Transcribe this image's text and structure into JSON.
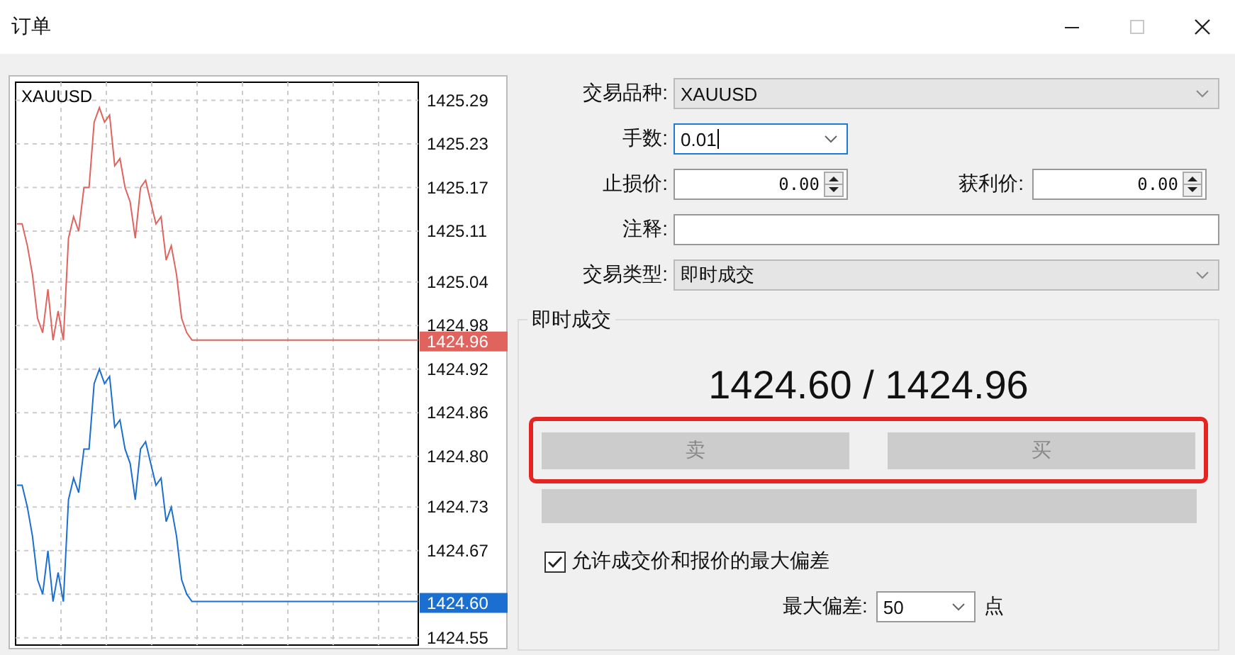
{
  "window": {
    "title": "订单",
    "controls": [
      {
        "kind": "minimize",
        "disabled": false
      },
      {
        "kind": "maximize",
        "disabled": true
      },
      {
        "kind": "close",
        "disabled": false
      }
    ]
  },
  "chart": {
    "symbol": "XAUUSD",
    "price_tags": [
      "1424.96",
      "1424.60"
    ],
    "chart_data": {
      "type": "line",
      "grid": true,
      "ylim": [
        1424.54,
        1425.315
      ],
      "yticks": [
        {
          "value": 1425.29,
          "label": "1425.29"
        },
        {
          "value": 1425.23,
          "label": "1425.23"
        },
        {
          "value": 1425.17,
          "label": "1425.17"
        },
        {
          "value": 1425.11,
          "label": "1425.11"
        },
        {
          "value": 1425.04,
          "label": "1425.04"
        },
        {
          "value": 1424.98,
          "label": "1424.98"
        },
        {
          "value": 1424.92,
          "label": "1424.92"
        },
        {
          "value": 1424.86,
          "label": "1424.86"
        },
        {
          "value": 1424.8,
          "label": "1424.80"
        },
        {
          "value": 1424.73,
          "label": "1424.73"
        },
        {
          "value": 1424.67,
          "label": "1424.67"
        },
        {
          "value": 1424.55,
          "label": "1424.55"
        }
      ],
      "series": [
        {
          "color": "#e0635e",
          "values": [
            1425.12,
            1425.12,
            1425.09,
            1425.05,
            1424.99,
            1424.97,
            1425.03,
            1424.96,
            1425.0,
            1424.96,
            1425.1,
            1425.13,
            1425.11,
            1425.17,
            1425.17,
            1425.26,
            1425.28,
            1425.26,
            1425.27,
            1425.2,
            1425.21,
            1425.17,
            1425.15,
            1425.1,
            1425.17,
            1425.18,
            1425.15,
            1425.12,
            1425.13,
            1425.07,
            1425.09,
            1425.05,
            1424.99,
            1424.97,
            1424.96,
            1424.96,
            1424.96,
            1424.96,
            1424.96,
            1424.96,
            1424.96,
            1424.96,
            1424.96,
            1424.96,
            1424.96,
            1424.96,
            1424.96,
            1424.96,
            1424.96,
            1424.96,
            1424.96,
            1424.96,
            1424.96,
            1424.96,
            1424.96,
            1424.96,
            1424.96,
            1424.96,
            1424.96,
            1424.96,
            1424.96,
            1424.96,
            1424.96,
            1424.96,
            1424.96,
            1424.96,
            1424.96,
            1424.96,
            1424.96,
            1424.96,
            1424.96,
            1424.96,
            1424.96,
            1424.96,
            1424.96,
            1424.96,
            1424.96,
            1424.96,
            1424.96
          ]
        },
        {
          "color": "#1a6fd1",
          "values": [
            1424.76,
            1424.76,
            1424.73,
            1424.69,
            1424.63,
            1424.61,
            1424.67,
            1424.6,
            1424.64,
            1424.6,
            1424.74,
            1424.77,
            1424.75,
            1424.81,
            1424.81,
            1424.9,
            1424.92,
            1424.9,
            1424.91,
            1424.84,
            1424.85,
            1424.81,
            1424.79,
            1424.74,
            1424.81,
            1424.82,
            1424.79,
            1424.76,
            1424.77,
            1424.71,
            1424.73,
            1424.69,
            1424.63,
            1424.61,
            1424.6,
            1424.6,
            1424.6,
            1424.6,
            1424.6,
            1424.6,
            1424.6,
            1424.6,
            1424.6,
            1424.6,
            1424.6,
            1424.6,
            1424.6,
            1424.6,
            1424.6,
            1424.6,
            1424.6,
            1424.6,
            1424.6,
            1424.6,
            1424.6,
            1424.6,
            1424.6,
            1424.6,
            1424.6,
            1424.6,
            1424.6,
            1424.6,
            1424.6,
            1424.6,
            1424.6,
            1424.6,
            1424.6,
            1424.6,
            1424.6,
            1424.6,
            1424.6,
            1424.6,
            1424.6,
            1424.6,
            1424.6,
            1424.6,
            1424.6,
            1424.6,
            1424.6
          ]
        }
      ]
    }
  },
  "form": {
    "symbol": {
      "label": "交易品种:",
      "value": "XAUUSD"
    },
    "volume": {
      "label": "手数:",
      "value": "0.01",
      "focused": true
    },
    "stop_loss": {
      "label": "止损价:",
      "value": "0.00"
    },
    "take_profit": {
      "label": "获利价:",
      "value": "0.00"
    },
    "comment": {
      "label": "注释:"
    },
    "order_type": {
      "label": "交易类型:",
      "value": "即时成交"
    }
  },
  "execution": {
    "title": "即时成交",
    "quote": "1424.60 / 1424.96",
    "highlighted": true,
    "buttons": [
      {
        "label": "卖",
        "disabled": true
      },
      {
        "label": "买",
        "disabled": true
      }
    ],
    "deviation_check": {
      "label": "允许成交价和报价的最大偏差",
      "checked": true
    },
    "deviation": {
      "label": "最大偏差:",
      "value": "50",
      "unit": "点"
    }
  }
}
